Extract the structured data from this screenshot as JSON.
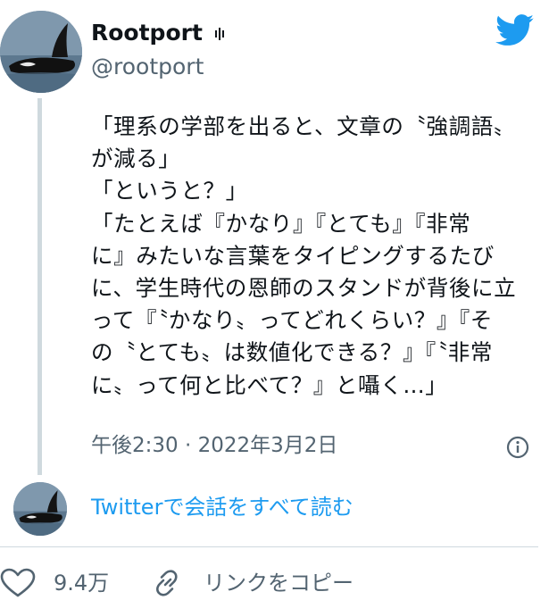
{
  "author": {
    "display_name": "Rootport",
    "username": "@rootport"
  },
  "tweet": {
    "lines": [
      "「理系の学部を出ると、文章の〝強調語〟",
      "が減る」",
      "「というと？」",
      "「たとえば『かなり』『とても』『非常",
      "に』みたいな言葉をタイピングするたび",
      "に、学生時代の恩師のスタンドが背後に立",
      "って『〝かなり〟ってどれくらい？』『そ",
      "の〝とても〟は数値化できる？』『〝非常",
      "に〟って何と比べて？』と囁く…」"
    ],
    "timestamp": "午後2:30 · 2022年3月2日"
  },
  "read_conversation": "Twitterで会話をすべて読む",
  "actions": {
    "like_count": "9.4万",
    "copy_link": "リンクをコピー"
  },
  "colors": {
    "brand_blue": "#1d9bf0",
    "secondary_text": "#536471",
    "thread_line": "#cfd9de"
  },
  "icons": [
    "twitter-bird-icon",
    "info-icon",
    "heart-icon",
    "link-icon"
  ]
}
